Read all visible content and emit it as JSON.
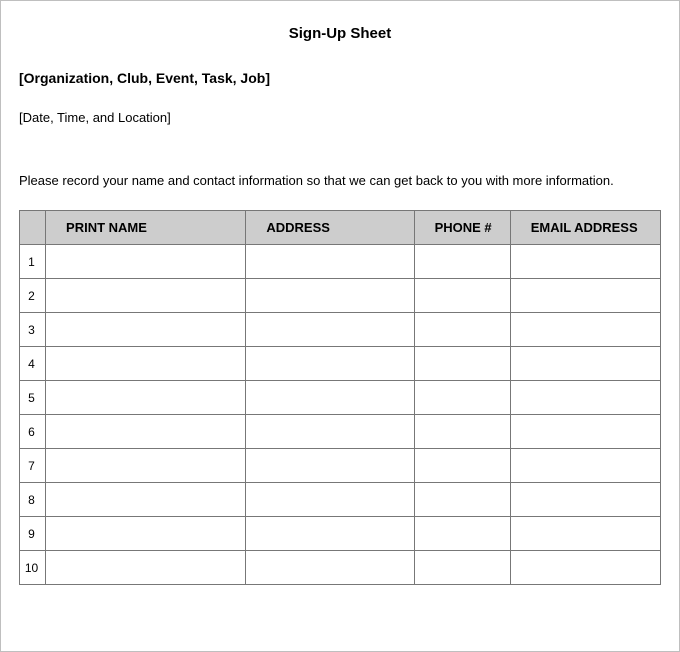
{
  "title": "Sign-Up Sheet",
  "org_placeholder": "[Organization, Club, Event, Task, Job]",
  "datetime_placeholder": "[Date, Time, and Location]",
  "instructions": "Please record your name and contact information so that we can get back to you with more information.",
  "columns": {
    "name": "PRINT NAME",
    "address": "ADDRESS",
    "phone": "PHONE #",
    "email": "EMAIL ADDRESS"
  },
  "rows": [
    {
      "n": "1",
      "name": "",
      "address": "",
      "phone": "",
      "email": ""
    },
    {
      "n": "2",
      "name": "",
      "address": "",
      "phone": "",
      "email": ""
    },
    {
      "n": "3",
      "name": "",
      "address": "",
      "phone": "",
      "email": ""
    },
    {
      "n": "4",
      "name": "",
      "address": "",
      "phone": "",
      "email": ""
    },
    {
      "n": "5",
      "name": "",
      "address": "",
      "phone": "",
      "email": ""
    },
    {
      "n": "6",
      "name": "",
      "address": "",
      "phone": "",
      "email": ""
    },
    {
      "n": "7",
      "name": "",
      "address": "",
      "phone": "",
      "email": ""
    },
    {
      "n": "8",
      "name": "",
      "address": "",
      "phone": "",
      "email": ""
    },
    {
      "n": "9",
      "name": "",
      "address": "",
      "phone": "",
      "email": ""
    },
    {
      "n": "10",
      "name": "",
      "address": "",
      "phone": "",
      "email": ""
    }
  ]
}
